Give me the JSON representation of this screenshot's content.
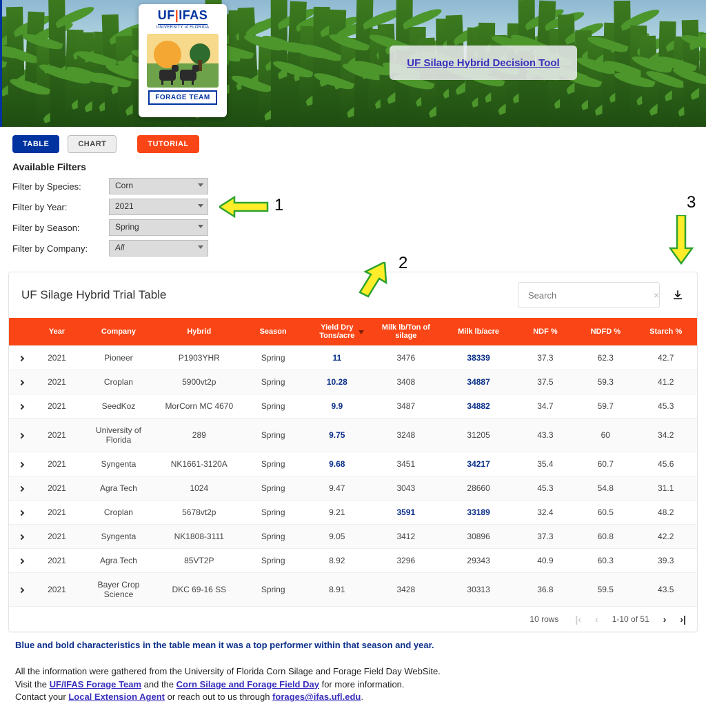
{
  "header": {
    "brand_line1": "UF|IFAS",
    "brand_line2": "UNIVERSITY of FLORIDA",
    "forage_badge": "FORAGE TEAM",
    "title_link": "UF Silage Hybrid Decision Tool"
  },
  "tabs": {
    "table": "TABLE",
    "chart": "CHART",
    "tutorial": "TUTORIAL"
  },
  "filters": {
    "heading": "Available Filters",
    "species": {
      "label": "Filter by Species:",
      "value": "Corn"
    },
    "year": {
      "label": "Filter by Year:",
      "value": "2021"
    },
    "season": {
      "label": "Filter by Season:",
      "value": "Spring"
    },
    "company": {
      "label": "Filter by Company:",
      "value": "All"
    }
  },
  "annotations": {
    "n1": "1",
    "n2": "2",
    "n3": "3"
  },
  "card": {
    "title": "UF Silage Hybrid Trial Table",
    "search_placeholder": "Search"
  },
  "columns": [
    "Year",
    "Company",
    "Hybrid",
    "Season",
    "Yield Dry Tons/acre",
    "Milk lb/Ton of silage",
    "Milk lb/acre",
    "NDF %",
    "NDFD %",
    "Starch %"
  ],
  "sorted_column_index": 4,
  "rows": [
    {
      "year": "2021",
      "company": "Pioneer",
      "hybrid": "P1903YHR",
      "season": "Spring",
      "yield": "11",
      "milk_ton": "3476",
      "milk_acre": "38339",
      "ndf": "37.3",
      "ndfd": "62.3",
      "starch": "42.7",
      "top": {
        "yield": true,
        "milk_acre": true
      }
    },
    {
      "year": "2021",
      "company": "Croplan",
      "hybrid": "5900vt2p",
      "season": "Spring",
      "yield": "10.28",
      "milk_ton": "3408",
      "milk_acre": "34887",
      "ndf": "37.5",
      "ndfd": "59.3",
      "starch": "41.2",
      "top": {
        "yield": true,
        "milk_acre": true
      }
    },
    {
      "year": "2021",
      "company": "SeedKoz",
      "hybrid": "MorCorn MC 4670",
      "season": "Spring",
      "yield": "9.9",
      "milk_ton": "3487",
      "milk_acre": "34882",
      "ndf": "34.7",
      "ndfd": "59.7",
      "starch": "45.3",
      "top": {
        "yield": true,
        "milk_acre": true
      }
    },
    {
      "year": "2021",
      "company": "University of Florida",
      "hybrid": "289",
      "season": "Spring",
      "yield": "9.75",
      "milk_ton": "3248",
      "milk_acre": "31205",
      "ndf": "43.3",
      "ndfd": "60",
      "starch": "34.2",
      "top": {
        "yield": true
      }
    },
    {
      "year": "2021",
      "company": "Syngenta",
      "hybrid": "NK1661-3120A",
      "season": "Spring",
      "yield": "9.68",
      "milk_ton": "3451",
      "milk_acre": "34217",
      "ndf": "35.4",
      "ndfd": "60.7",
      "starch": "45.6",
      "top": {
        "yield": true,
        "milk_acre": true
      }
    },
    {
      "year": "2021",
      "company": "Agra Tech",
      "hybrid": "1024",
      "season": "Spring",
      "yield": "9.47",
      "milk_ton": "3043",
      "milk_acre": "28660",
      "ndf": "45.3",
      "ndfd": "54.8",
      "starch": "31.1",
      "top": {}
    },
    {
      "year": "2021",
      "company": "Croplan",
      "hybrid": "5678vt2p",
      "season": "Spring",
      "yield": "9.21",
      "milk_ton": "3591",
      "milk_acre": "33189",
      "ndf": "32.4",
      "ndfd": "60.5",
      "starch": "48.2",
      "top": {
        "milk_ton": true,
        "milk_acre": true
      }
    },
    {
      "year": "2021",
      "company": "Syngenta",
      "hybrid": "NK1808-3111",
      "season": "Spring",
      "yield": "9.05",
      "milk_ton": "3412",
      "milk_acre": "30896",
      "ndf": "37.3",
      "ndfd": "60.8",
      "starch": "42.2",
      "top": {}
    },
    {
      "year": "2021",
      "company": "Agra Tech",
      "hybrid": "85VT2P",
      "season": "Spring",
      "yield": "8.92",
      "milk_ton": "3296",
      "milk_acre": "29343",
      "ndf": "40.9",
      "ndfd": "60.3",
      "starch": "39.3",
      "top": {}
    },
    {
      "year": "2021",
      "company": "Bayer Crop Science",
      "hybrid": "DKC 69-16 SS",
      "season": "Spring",
      "yield": "8.91",
      "milk_ton": "3428",
      "milk_acre": "30313",
      "ndf": "36.8",
      "ndfd": "59.5",
      "starch": "43.5",
      "top": {}
    }
  ],
  "pager": {
    "page_size_label": "10 rows",
    "range_label": "1-10 of 51"
  },
  "footer": {
    "top_perf_note": "Blue and bold characteristics in the table mean it was a top performer within that season and year.",
    "line1": "All the information were gathered from the University of Florida Corn Silage and Forage Field Day WebSite.",
    "visit_prefix": "Visit the ",
    "link1": "UF/IFAS Forage Team",
    "and": " and the ",
    "link2": "Corn Silage and Forage Field Day",
    "visit_suffix": " for more information.",
    "contact_prefix": "Contact your ",
    "link3": "Local Extension Agent",
    "contact_mid": " or reach out to us through ",
    "email": "forages@ifas.ufl.edu",
    "period": "."
  }
}
